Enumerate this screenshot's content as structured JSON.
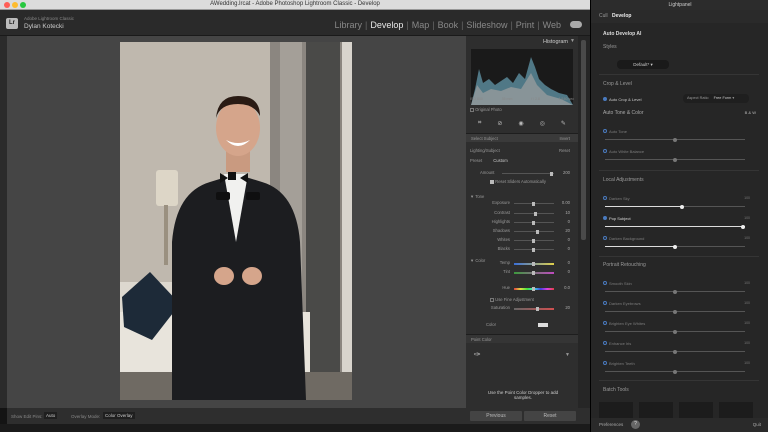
{
  "window": {
    "title": "AWedding.lrcat - Adobe Photoshop Lightroom Classic - Develop"
  },
  "lr_header": {
    "catalog": "Adobe Lightroom Classic",
    "user": "Dylan Kotecki",
    "modules": [
      "Library",
      "Develop",
      "Map",
      "Book",
      "Slideshow",
      "Print",
      "Web"
    ],
    "active_module": "Develop"
  },
  "right_panel": {
    "histogram_label": "Histogram",
    "histogram_stats": [
      "ISO 800",
      "35 mm",
      "f / 2.8",
      "1/160 sec"
    ],
    "original_photo": "Original Photo",
    "select_subject": "Select Subject",
    "invert": "Invert",
    "mask_name": "Lighting/Subject",
    "reset": "Reset",
    "preset_label": "Preset",
    "preset_value": "Custom",
    "amount_label": "Amount",
    "amount_value": "200",
    "reset_sliders": "Reset Sliders Automatically",
    "tone_label": "Tone",
    "tone_rows": [
      {
        "label": "Exposure",
        "value": "0.00"
      },
      {
        "label": "Contrast",
        "value": "10"
      },
      {
        "label": "Highlights",
        "value": "0"
      },
      {
        "label": "Shadows",
        "value": "20"
      },
      {
        "label": "Whites",
        "value": "0"
      },
      {
        "label": "Blacks",
        "value": "0"
      }
    ],
    "color_label": "Color",
    "color_rows": [
      {
        "label": "Temp",
        "value": "0"
      },
      {
        "label": "Tint",
        "value": "0"
      },
      {
        "label": "Hue",
        "value": "0.0"
      },
      {
        "label": "Saturation",
        "value": "20"
      }
    ],
    "fine_adjust": "Use Fine Adjustment",
    "color_label2": "Color",
    "point_color": "Point Color",
    "point_color_hint": "Use the Point Color Dropper to add samples.",
    "previous_button": "Previous",
    "reset_button": "Reset"
  },
  "toolbar": {
    "show_edit_pins_label": "Show Edit Pins:",
    "show_edit_pins_value": "Auto",
    "overlay_mode_label": "Overlay Mode:",
    "overlay_mode_value": "Color Overlay"
  },
  "lightpanel": {
    "title": "Lightpanel",
    "tabs": [
      "Cull",
      "Develop"
    ],
    "active_tab": "Develop",
    "auto_develop": "Auto Develop AI",
    "styles": "Styles",
    "style_value": "Default*",
    "crop_level": "Crop & Level",
    "auto_crop": "Auto Crop & Level",
    "aspect_ratio": "Aspect Ratio",
    "free_form": "Free Form",
    "auto_tone_color": "Auto Tone & Color",
    "bw": "B & W",
    "auto_tone": "Auto Tone",
    "auto_wb": "Auto White Balance",
    "local_adjustments": "Local Adjustments",
    "local_items": [
      {
        "label": "Darken Sky",
        "value": "100",
        "level": 0.55,
        "on": false
      },
      {
        "label": "Pop Subject",
        "value": "100",
        "level": 1.0,
        "on": true
      },
      {
        "label": "Darken Background",
        "value": "100",
        "level": 0.5,
        "on": false
      }
    ],
    "portrait_retouching": "Portrait Retouching",
    "portrait_items": [
      {
        "label": "Smooth Skin",
        "value": "100"
      },
      {
        "label": "Darken Eyebrows",
        "value": "100"
      },
      {
        "label": "Brighten Eye Whites",
        "value": "100"
      },
      {
        "label": "Enhance Iris",
        "value": "100"
      },
      {
        "label": "Brighten Teeth",
        "value": "100"
      }
    ],
    "batch_tools": "Batch Tools",
    "preferences": "Preferences",
    "quit": "Quit",
    "accent": "#4a7bbf"
  }
}
